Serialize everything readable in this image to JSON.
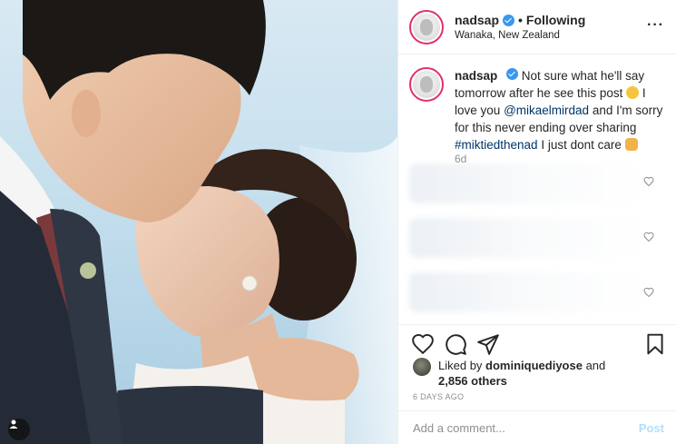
{
  "post": {
    "username": "nadsap",
    "follow_status": "Following",
    "location": "Wanaka, New Zealand",
    "more_icon": "ellipsis-icon",
    "caption": {
      "text_1": "Not sure what he'll say tomorrow after he see this post",
      "text_2": "I love you",
      "mention": "@mikaelmirdad",
      "text_3": "and I'm sorry for this never ending over sharing",
      "hashtag": "#miktiedthenad",
      "text_4": "I just dont care"
    },
    "age": "6d",
    "liked_by_prefix": "Liked by",
    "liked_by_user": "dominiquediyose",
    "liked_by_and": "and",
    "others_count": "2,856 others",
    "date": "6 DAYS AGO",
    "comment_placeholder": "Add a comment...",
    "post_button": "Post"
  },
  "colors": {
    "verified": "#3897f0",
    "link": "#003569",
    "post_button_disabled": "#b2dffc",
    "secondary_text": "#8e8e8e"
  }
}
